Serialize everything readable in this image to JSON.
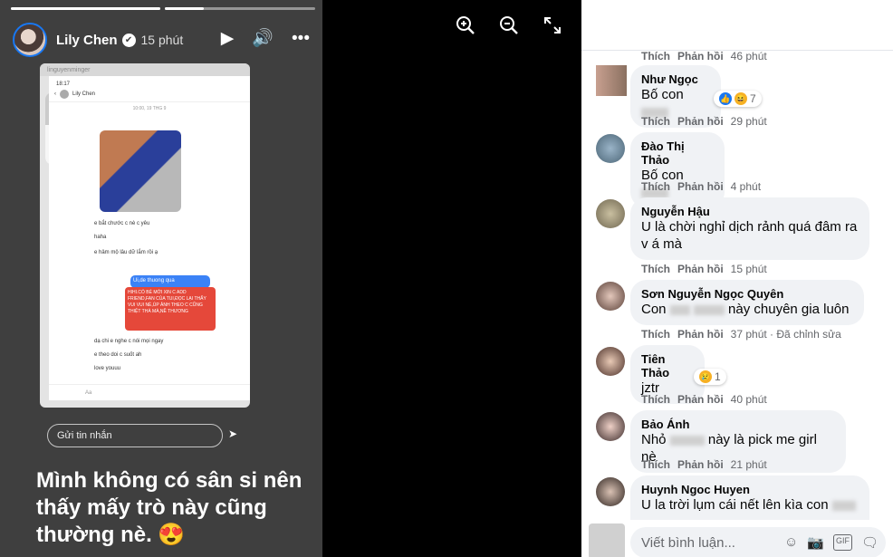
{
  "story": {
    "author": "Lily Chen",
    "time": "15 phút",
    "reply_placeholder": "Gửi tin nhắn",
    "caption": "Mình không có sân si nên thấy mấy trò này cũng thường nè. 😍",
    "progress_segments": [
      1.0,
      0.26
    ],
    "volume_level": 0.55,
    "overlay_username": "linguyenminger",
    "phone": {
      "status_time": "18:17",
      "chat_name": "Lily Chen",
      "date_label": "10:00, 19 THG 9",
      "messages_left": [
        "e bắt chước c nè c yêu",
        "haha",
        "e hâm mộ lâu dữ lắm rồi ạ",
        "dạ chi e nghe c nói mọi ngay",
        "e theo doi c suốt ah",
        "love youuu"
      ],
      "blue_bubble": "Ui,de thuong qua",
      "red_bubble": "HIHI.CÓ BÉ MỚI XIN C ADD FRIEND,FAN CỦA TUI,ĐỌC LẠI THẤY VUI VUI NÈ,ÚP ẢNH THEO C CŨNG THIỆT THÀ MÀ,NỀ THƯƠNG",
      "input_placeholder": "Aa"
    }
  },
  "viewer_tools": [
    "zoom-in-icon",
    "zoom-out-icon",
    "fullscreen-icon"
  ],
  "comments": [
    {
      "name": "",
      "text": "",
      "actions": {
        "like": "Thích",
        "reply": "Phản hồi",
        "time": "46 phút"
      }
    },
    {
      "name": "Như Ngọc",
      "text_pre": "Bố con",
      "reaction_count": "7",
      "actions": {
        "like": "Thích",
        "reply": "Phản hồi",
        "time": "29 phút"
      }
    },
    {
      "name": "Đào Thị Thảo",
      "text_pre": "Bố con",
      "actions": {
        "like": "Thích",
        "reply": "Phản hồi",
        "time": "4 phút"
      }
    },
    {
      "name": "Nguyễn Hậu",
      "text": "U là chời nghỉ dịch rảnh quá đâm ra v á mà",
      "actions": {
        "like": "Thích",
        "reply": "Phản hồi",
        "time": "15 phút"
      }
    },
    {
      "name": "Sơn Nguyễn Ngọc Quyên",
      "text_pre": "Con",
      "text_post": "này chuyên gia luôn",
      "actions": {
        "like": "Thích",
        "reply": "Phản hồi",
        "time": "37 phút",
        "extra": "Đã chỉnh sửa"
      }
    },
    {
      "name": "Tiên Thảo",
      "text": "jztr",
      "reaction_count": "1",
      "actions": {
        "like": "Thích",
        "reply": "Phản hồi",
        "time": "40 phút"
      }
    },
    {
      "name": "Bảo Ánh",
      "text_pre": "Nhỏ",
      "text_post": "này là pick me girl nè",
      "actions": {
        "like": "Thích",
        "reply": "Phản hồi",
        "time": "21 phút"
      }
    },
    {
      "name": "Huynh Ngoc Huyen",
      "text_pre": "U la trời lụm cái nết lên kìa con"
    }
  ],
  "composer": {
    "placeholder": "Viết bình luận..."
  },
  "colors": {
    "accent": "#1877f2",
    "bubble": "#f0f2f5",
    "meta": "#65676b",
    "story_bg": "#3f3f3f"
  }
}
